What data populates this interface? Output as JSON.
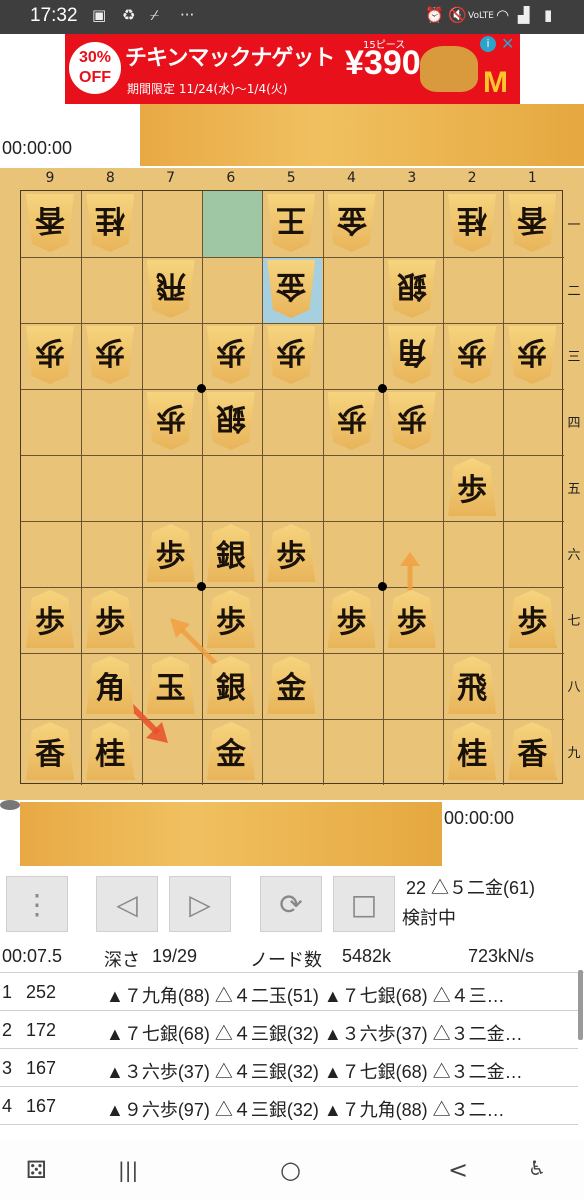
{
  "status_bar": {
    "time": "17:32",
    "left_icons": [
      "image-icon",
      "sync-icon",
      "broom-icon",
      "more-icon"
    ],
    "more": "···",
    "right_icons": [
      "alarm-icon",
      "mute-icon",
      "volte-icon",
      "wifi-icon",
      "signal-icon",
      "battery-icon"
    ],
    "volte": "VoLTE"
  },
  "ad": {
    "badge_top": "30%",
    "badge_bottom": "OFF",
    "title": "チキンマックナゲット",
    "subtitle": "期間限定 11/24(水)〜1/4(火)",
    "pieces": "15ピース",
    "price": "¥390",
    "brand_logo": "M",
    "info_icon": "i",
    "close_icon": "✕"
  },
  "gote": {
    "timer": "00:00:00"
  },
  "sente": {
    "timer": "00:00:00"
  },
  "board": {
    "files": [
      "9",
      "8",
      "7",
      "6",
      "5",
      "4",
      "3",
      "2",
      "1"
    ],
    "ranks": [
      "一",
      "二",
      "三",
      "四",
      "五",
      "六",
      "七",
      "八",
      "九"
    ],
    "highlight_color": "#9fc7a3",
    "highlight_color2": "#a6cfe0",
    "pieces": [
      {
        "f": 9,
        "r": 1,
        "p": "香",
        "side": "gote"
      },
      {
        "f": 8,
        "r": 1,
        "p": "桂",
        "side": "gote"
      },
      {
        "f": 5,
        "r": 1,
        "p": "王",
        "side": "gote"
      },
      {
        "f": 4,
        "r": 1,
        "p": "金",
        "side": "gote"
      },
      {
        "f": 2,
        "r": 1,
        "p": "桂",
        "side": "gote"
      },
      {
        "f": 1,
        "r": 1,
        "p": "香",
        "side": "gote"
      },
      {
        "f": 7,
        "r": 2,
        "p": "飛",
        "side": "gote"
      },
      {
        "f": 5,
        "r": 2,
        "p": "金",
        "side": "gote"
      },
      {
        "f": 3,
        "r": 2,
        "p": "銀",
        "side": "gote"
      },
      {
        "f": 9,
        "r": 3,
        "p": "歩",
        "side": "gote"
      },
      {
        "f": 8,
        "r": 3,
        "p": "歩",
        "side": "gote"
      },
      {
        "f": 6,
        "r": 3,
        "p": "歩",
        "side": "gote"
      },
      {
        "f": 5,
        "r": 3,
        "p": "歩",
        "side": "gote"
      },
      {
        "f": 3,
        "r": 3,
        "p": "角",
        "side": "gote"
      },
      {
        "f": 2,
        "r": 3,
        "p": "歩",
        "side": "gote"
      },
      {
        "f": 1,
        "r": 3,
        "p": "歩",
        "side": "gote"
      },
      {
        "f": 7,
        "r": 4,
        "p": "歩",
        "side": "gote"
      },
      {
        "f": 6,
        "r": 4,
        "p": "銀",
        "side": "gote"
      },
      {
        "f": 4,
        "r": 4,
        "p": "歩",
        "side": "gote"
      },
      {
        "f": 3,
        "r": 4,
        "p": "歩",
        "side": "gote"
      },
      {
        "f": 2,
        "r": 5,
        "p": "歩",
        "side": "sente"
      },
      {
        "f": 7,
        "r": 6,
        "p": "歩",
        "side": "sente"
      },
      {
        "f": 6,
        "r": 6,
        "p": "銀",
        "side": "sente"
      },
      {
        "f": 5,
        "r": 6,
        "p": "歩",
        "side": "sente"
      },
      {
        "f": 9,
        "r": 7,
        "p": "歩",
        "side": "sente"
      },
      {
        "f": 8,
        "r": 7,
        "p": "歩",
        "side": "sente"
      },
      {
        "f": 6,
        "r": 7,
        "p": "歩",
        "side": "sente"
      },
      {
        "f": 4,
        "r": 7,
        "p": "歩",
        "side": "sente"
      },
      {
        "f": 3,
        "r": 7,
        "p": "歩",
        "side": "sente"
      },
      {
        "f": 1,
        "r": 7,
        "p": "歩",
        "side": "sente"
      },
      {
        "f": 8,
        "r": 8,
        "p": "角",
        "side": "sente"
      },
      {
        "f": 7,
        "r": 8,
        "p": "玉",
        "side": "sente"
      },
      {
        "f": 6,
        "r": 8,
        "p": "銀",
        "side": "sente"
      },
      {
        "f": 5,
        "r": 8,
        "p": "金",
        "side": "sente"
      },
      {
        "f": 2,
        "r": 8,
        "p": "飛",
        "side": "sente"
      },
      {
        "f": 9,
        "r": 9,
        "p": "香",
        "side": "sente"
      },
      {
        "f": 8,
        "r": 9,
        "p": "桂",
        "side": "sente"
      },
      {
        "f": 6,
        "r": 9,
        "p": "金",
        "side": "sente"
      },
      {
        "f": 2,
        "r": 9,
        "p": "桂",
        "side": "sente"
      },
      {
        "f": 1,
        "r": 9,
        "p": "香",
        "side": "sente"
      }
    ]
  },
  "controls": {
    "menu_icon": "⋮",
    "prev_icon": "◁",
    "next_icon": "▷",
    "analyze_icon": "⟳",
    "stop_icon": "□"
  },
  "move_info": {
    "last_move": "22 △５二金(61)",
    "state": "検討中"
  },
  "engine": {
    "time": "00:07.5",
    "depth_label": "深さ",
    "depth": "19/29",
    "nodes_label": "ノード数",
    "nodes": "5482k",
    "nps": "723kN/s"
  },
  "pv": [
    {
      "n": "1",
      "score": "252",
      "moves": "▲７九角(88) △４二玉(51) ▲７七銀(68) △４三…"
    },
    {
      "n": "2",
      "score": "172",
      "moves": "▲７七銀(68) △４三銀(32) ▲３六歩(37) △３二金…"
    },
    {
      "n": "3",
      "score": "167",
      "moves": "▲３六歩(37) △４三銀(32) ▲７七銀(68) △３二金…"
    },
    {
      "n": "4",
      "score": "167",
      "moves": "▲９六歩(97) △４三銀(32) ▲７九角(88) △３二…"
    }
  ],
  "nav": {
    "game_icon": "⚄",
    "recents_icon": "|||",
    "home_icon": "○",
    "back_icon": "<",
    "accessibility_icon": "♿"
  }
}
